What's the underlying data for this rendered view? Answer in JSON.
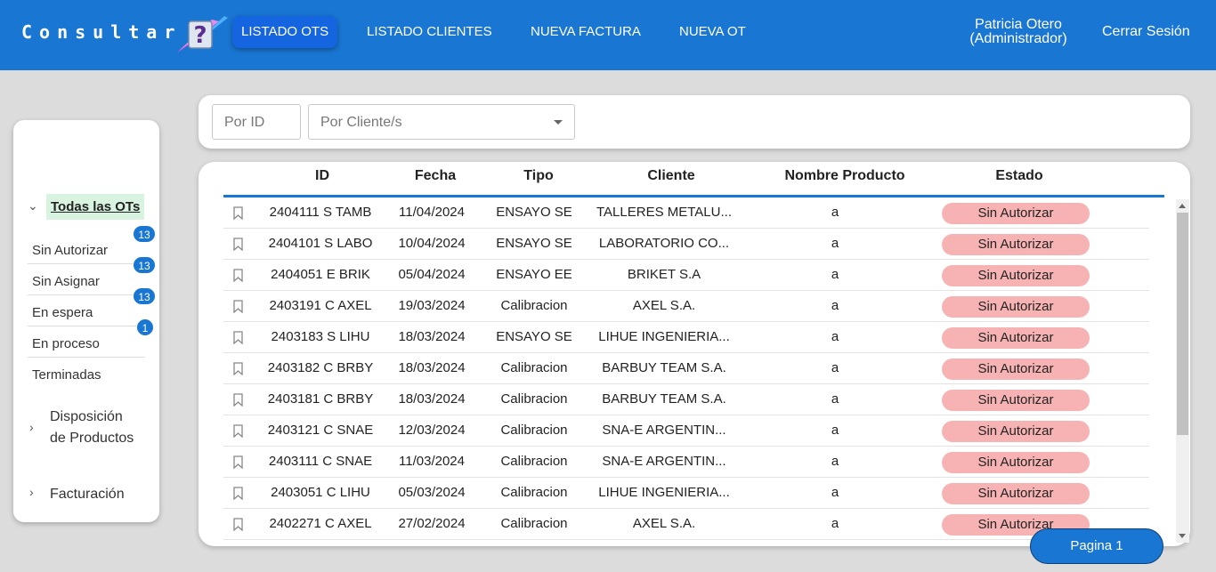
{
  "header": {
    "brand": "Consultar",
    "nav": [
      "LISTADO OTS",
      "LISTADO CLIENTES",
      "NUEVA FACTURA",
      "NUEVA OT"
    ],
    "active_nav": "LISTADO OTS",
    "user_name": "Patricia Otero",
    "user_role": "(Administrador)",
    "logout": "Cerrar Sesión"
  },
  "sidebar": {
    "all_label": "Todas las OTs",
    "items": [
      {
        "label": "Sin Autorizar",
        "count": "13"
      },
      {
        "label": "Sin Asignar",
        "count": "13"
      },
      {
        "label": "En espera",
        "count": "13"
      },
      {
        "label": "En proceso",
        "count": "1"
      },
      {
        "label": "Terminadas",
        "count": ""
      }
    ],
    "disposicion_line1": "Disposición",
    "disposicion_line2": "de Productos",
    "facturacion": "Facturación"
  },
  "filters": {
    "id_placeholder": "Por ID",
    "client_placeholder": "Por Cliente/s"
  },
  "table": {
    "columns": [
      "ID",
      "Fecha",
      "Tipo",
      "Cliente",
      "Nombre Producto",
      "Estado"
    ],
    "rows": [
      {
        "id": "2404111 S TAMB",
        "fecha": "11/04/2024",
        "tipo": "ENSAYO SE",
        "cliente": "TALLERES METALU...",
        "producto": "a",
        "estado": "Sin Autorizar"
      },
      {
        "id": "2404101 S LABO",
        "fecha": "10/04/2024",
        "tipo": "ENSAYO SE",
        "cliente": "LABORATORIO CO...",
        "producto": "a",
        "estado": "Sin Autorizar"
      },
      {
        "id": "2404051 E BRIK",
        "fecha": "05/04/2024",
        "tipo": "ENSAYO EE",
        "cliente": "BRIKET S.A",
        "producto": "a",
        "estado": "Sin Autorizar"
      },
      {
        "id": "2403191 C AXEL",
        "fecha": "19/03/2024",
        "tipo": "Calibracion",
        "cliente": "AXEL S.A.",
        "producto": "a",
        "estado": "Sin Autorizar"
      },
      {
        "id": "2403183 S LIHU",
        "fecha": "18/03/2024",
        "tipo": "ENSAYO SE",
        "cliente": "LIHUE INGENIERIA...",
        "producto": "a",
        "estado": "Sin Autorizar"
      },
      {
        "id": "2403182 C BRBY",
        "fecha": "18/03/2024",
        "tipo": "Calibracion",
        "cliente": "BARBUY TEAM S.A.",
        "producto": "a",
        "estado": "Sin Autorizar"
      },
      {
        "id": "2403181 C BRBY",
        "fecha": "18/03/2024",
        "tipo": "Calibracion",
        "cliente": "BARBUY TEAM S.A.",
        "producto": "a",
        "estado": "Sin Autorizar"
      },
      {
        "id": "2403121 C SNAE",
        "fecha": "12/03/2024",
        "tipo": "Calibracion",
        "cliente": "SNA-E ARGENTIN...",
        "producto": "a",
        "estado": "Sin Autorizar"
      },
      {
        "id": "2403111 C SNAE",
        "fecha": "11/03/2024",
        "tipo": "Calibracion",
        "cliente": "SNA-E ARGENTIN...",
        "producto": "a",
        "estado": "Sin Autorizar"
      },
      {
        "id": "2403051 C LIHU",
        "fecha": "05/03/2024",
        "tipo": "Calibracion",
        "cliente": "LIHUE INGENIERIA...",
        "producto": "a",
        "estado": "Sin Autorizar"
      },
      {
        "id": "2402271 C AXEL",
        "fecha": "27/02/2024",
        "tipo": "Calibracion",
        "cliente": "AXEL S.A.",
        "producto": "a",
        "estado": "Sin Autorizar"
      }
    ]
  },
  "pagination": {
    "label": "Pagina 1"
  }
}
